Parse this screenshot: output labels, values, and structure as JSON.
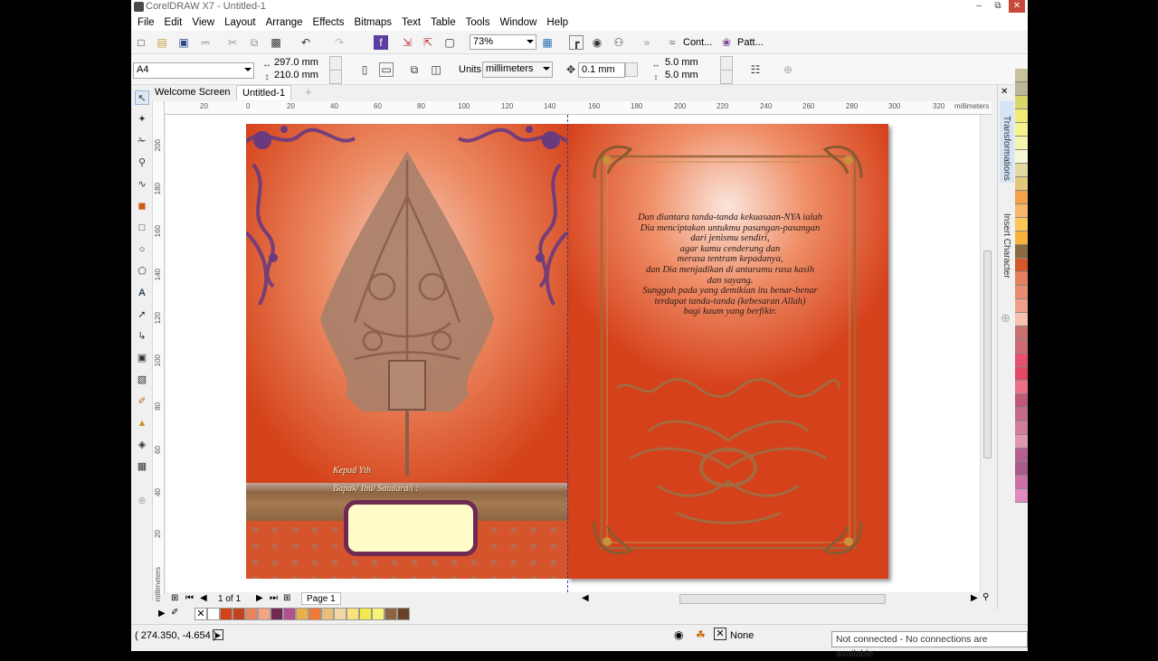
{
  "window": {
    "title": "CorelDRAW X7 - Untitled-1"
  },
  "menu": [
    "File",
    "Edit",
    "View",
    "Layout",
    "Arrange",
    "Effects",
    "Bitmaps",
    "Text",
    "Table",
    "Tools",
    "Window",
    "Help"
  ],
  "standard_toolbar": {
    "zoom": "73%",
    "contour_label": "Cont...",
    "pattern_label": "Patt..."
  },
  "property_bar": {
    "page_size": "A4",
    "width": "297.0 mm",
    "height": "210.0 mm",
    "units_label": "Units:",
    "units_value": "millimeters",
    "nudge": "0.1 mm",
    "dup_x": "5.0 mm",
    "dup_y": "5.0 mm"
  },
  "tabs": [
    {
      "label": "Welcome Screen"
    },
    {
      "label": "Untitled-1"
    }
  ],
  "ruler": {
    "unit": "millimeters",
    "h_ticks": [
      "20",
      "0",
      "20",
      "40",
      "60",
      "80",
      "100",
      "120",
      "140",
      "160",
      "180",
      "200",
      "220",
      "240",
      "260",
      "280",
      "300",
      "320"
    ],
    "v_ticks": [
      "200",
      "180",
      "160",
      "140",
      "120",
      "100",
      "80",
      "60",
      "40",
      "20",
      "0"
    ]
  },
  "dockers": {
    "transformations": "Transformations",
    "insert_character": "Insert Character"
  },
  "page_nav": {
    "position": "1 of 1",
    "page_tab": "Page 1"
  },
  "status": {
    "coords": "( 274.350, -4.654 )",
    "outline": "None",
    "connection": "Not connected - No connections are available"
  },
  "design": {
    "cover_text_1": "Kepad Yth",
    "cover_text_2": "Bapak/ Ibu/ Saudara/i :",
    "verse_lines": [
      "Dan diantara tanda-tanda kekuasaan-NYA ialah",
      "Dia menciptakan untukmu pasangan-pasangan",
      "dari jenismu sendiri,",
      "agar kamu cenderung dan",
      "merasa tentram kepadanya,",
      "dan Dia menjadikan di antaramu rasa kasih",
      "dan sayang.",
      "Sungguh pada yang demikian itu benar-benar",
      "terdapat tanda-tanda (kebesaran Allah)",
      "bagi kaum yang berfikir."
    ]
  },
  "colors": {
    "palette": [
      "#c9c19a",
      "#bdb795",
      "#d7d86a",
      "#f0ec73",
      "#f6f58d",
      "#f4f3b0",
      "#f7f6d7",
      "#e6d8a2",
      "#e5c77b",
      "#f2a24a",
      "#f6b86a",
      "#fbc85a",
      "#f8b43a",
      "#8a6b44",
      "#d8572a",
      "#e58060",
      "#e98d72",
      "#f0a08a",
      "#f6c1ad",
      "#c87070",
      "#d06a72",
      "#e8516d",
      "#e34864",
      "#f06f88",
      "#c05878",
      "#c46b8c",
      "#d07e9b",
      "#e096b0",
      "#b66090",
      "#a85a88",
      "#cc70a8",
      "#e08ac0"
    ],
    "doc_palette": [
      "#ffffff",
      "#d4421a",
      "#c0421f",
      "#e9835e",
      "#f3a582",
      "#6e2a52",
      "#b05090",
      "#e8b04a",
      "#ef7a38",
      "#e6c07a",
      "#f5d7a5",
      "#fbe17a",
      "#f4e84a",
      "#f6f57a",
      "#8d6542",
      "#6a4127"
    ]
  }
}
